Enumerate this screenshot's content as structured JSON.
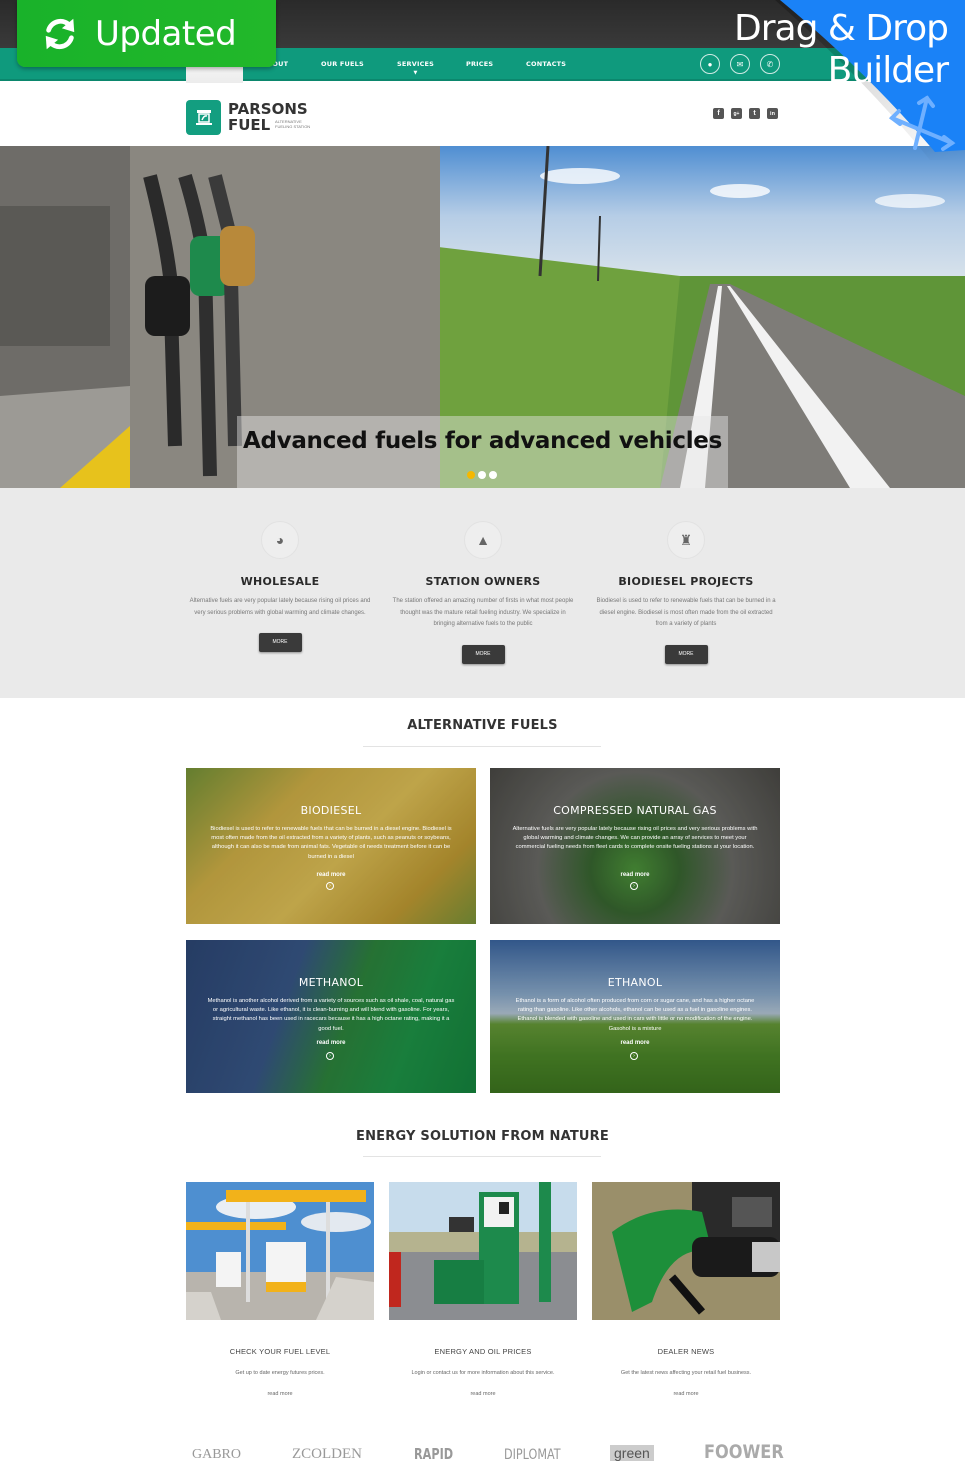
{
  "badge": {
    "label": "Updated",
    "icon": "sync-icon",
    "color": "#1cb52a"
  },
  "ribbon": {
    "line1": "Drag & Drop",
    "line2": "Builder",
    "icon": "move-arrows-icon",
    "color": "#1a82f7"
  },
  "nav": {
    "items": [
      {
        "label": "ABOUT"
      },
      {
        "label": "OUR FUELS"
      },
      {
        "label": "SERVICES"
      },
      {
        "label": "PRICES"
      },
      {
        "label": "CONTACTS"
      }
    ],
    "icons": [
      "map-marker-icon",
      "envelope-icon",
      "phone-icon"
    ],
    "accent": "#0f9a7d"
  },
  "logo": {
    "line1": "PARSONS",
    "line2": "FUEL",
    "tagline1": "ALTERNATIVE",
    "tagline2": "FUELING STATION"
  },
  "socials": [
    {
      "name": "facebook",
      "glyph": "f"
    },
    {
      "name": "google-plus",
      "glyph": "g+"
    },
    {
      "name": "twitter",
      "glyph": "t"
    },
    {
      "name": "linkedin",
      "glyph": "in"
    }
  ],
  "hero": {
    "caption": "Advanced fuels for advanced vehicles",
    "slides": 3,
    "active_slide": 1
  },
  "services": [
    {
      "icon": "globe-icon",
      "title": "WHOLESALE",
      "text": "Alternative fuels are very popular lately because rising oil prices and very serious problems with global warming and climate changes.",
      "button": "MORE"
    },
    {
      "icon": "station-icon",
      "title": "STATION OWNERS",
      "text": "The station offered an amazing number of firsts in what most people thought was the mature retail fueling industry. We specialize in bringing alternative fuels to the public",
      "button": "MORE"
    },
    {
      "icon": "pump-icon",
      "title": "BIODIESEL PROJECTS",
      "text": "Biodiesel is used to refer to renewable fuels that can be burned in a diesel engine. Biodiesel is most often made from the oil extracted from a variety of plants",
      "button": "MORE"
    }
  ],
  "alt_fuels": {
    "title": "ALTERNATIVE FUELS",
    "tiles": [
      {
        "title": "BIODIESEL",
        "text": "Biodiesel is used to refer to renewable fuels that can be burned in a diesel engine. Biodiesel is most often made from the oil extracted from a variety of plants, such as peanuts or soybeans, although it can also be made from animal fats. Vegetable oil needs treatment before it can be burned in a diesel",
        "more": "read more"
      },
      {
        "title": "COMPRESSED NATURAL GAS",
        "text": "Alternative fuels are very popular lately because rising oil prices and very serious problems with global warming and climate changes. We can provide an array of services to meet your commercial fueling needs from fleet cards to complete onsite fueling stations at your location.",
        "more": "read more"
      },
      {
        "title": "METHANOL",
        "text": "Methanol is another alcohol derived from a variety of sources such as oil shale, coal, natural gas or agricultural waste. Like ethanol, it is clean-burning and will blend with gasoline. For years, straight methanol has been used in racecars because it has a high octane rating, making it a good fuel.",
        "more": "read more"
      },
      {
        "title": "ETHANOL",
        "text": "Ethanol is a form of alcohol often produced from corn or sugar cane, and has a higher octane rating than gasoline. Like other alcohols, ethanol can be used as a fuel in gasoline engines. Ethanol is blended with gasoline and used in cars with little or no modification of the engine. Gasohol is a mixture",
        "more": "read more"
      }
    ]
  },
  "energy": {
    "title": "ENERGY SOLUTION FROM NATURE",
    "cards": [
      {
        "title": "CHECK YOUR FUEL LEVEL",
        "text": "Get up to date energy futures prices.",
        "more": "read more"
      },
      {
        "title": "ENERGY AND OIL PRICES",
        "text": "Login or contact us for more information about this service.",
        "more": "read more"
      },
      {
        "title": "DEALER NEWS",
        "text": "Get the latest news  affecting your retail fuel business.",
        "more": "read more"
      }
    ]
  },
  "brands": [
    "GABRO",
    "ZCOLDEN",
    "RAPID",
    "DIPLOMAT",
    "green",
    "FOOWER"
  ]
}
